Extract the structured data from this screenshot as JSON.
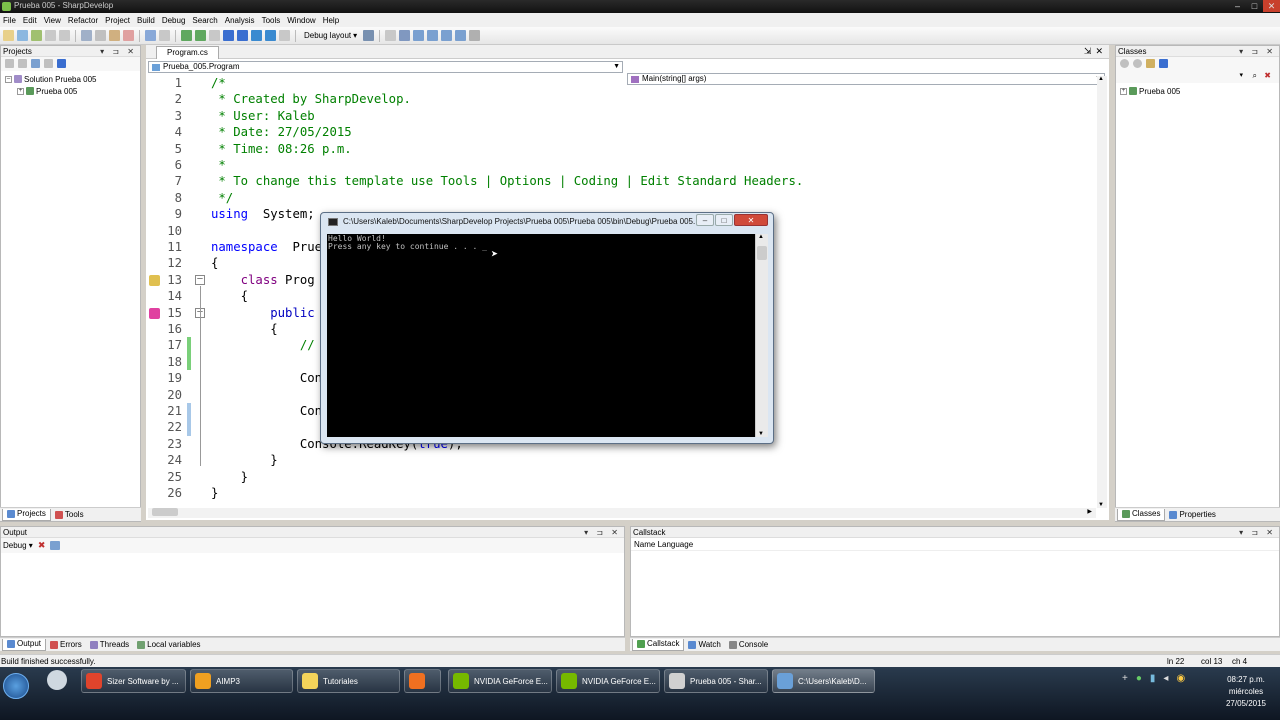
{
  "window": {
    "title": "Prueba 005 - SharpDevelop"
  },
  "menu": [
    "File",
    "Edit",
    "View",
    "Refactor",
    "Project",
    "Build",
    "Debug",
    "Search",
    "Analysis",
    "Tools",
    "Window",
    "Help"
  ],
  "toolbar": {
    "layout_label": "Debug layout"
  },
  "projects_panel": {
    "title": "Projects",
    "tree": [
      {
        "label": "Solution Prueba 005",
        "level": 0
      },
      {
        "label": "Prueba 005",
        "level": 1
      }
    ],
    "tabs": [
      "Projects",
      "Tools"
    ]
  },
  "editor": {
    "tab": "Program.cs",
    "class_combo": "Prueba_005.Program",
    "member_combo": "Main(string[] args)",
    "lines": [
      {
        "n": "1",
        "t": [
          [
            "cm",
            "/*"
          ]
        ]
      },
      {
        "n": "2",
        "t": [
          [
            "cm",
            " * Created by SharpDevelop."
          ]
        ]
      },
      {
        "n": "3",
        "t": [
          [
            "cm",
            " * User: Kaleb"
          ]
        ]
      },
      {
        "n": "4",
        "t": [
          [
            "cm",
            " * Date: 27/05/2015"
          ]
        ]
      },
      {
        "n": "5",
        "t": [
          [
            "cm",
            " * Time: 08:26 p.m."
          ]
        ]
      },
      {
        "n": "6",
        "t": [
          [
            "cm",
            " *"
          ]
        ]
      },
      {
        "n": "7",
        "t": [
          [
            "cm",
            " * To change this template use Tools | Options | Coding | Edit Standard Headers."
          ]
        ]
      },
      {
        "n": "8",
        "t": [
          [
            "cm",
            " */"
          ]
        ]
      },
      {
        "n": "9",
        "t": [
          [
            "kw",
            "using"
          ],
          [
            "",
            "  System;"
          ]
        ]
      },
      {
        "n": "10",
        "t": []
      },
      {
        "n": "11",
        "t": [
          [
            "kw",
            "namespace"
          ],
          [
            "",
            "  Prueb"
          ]
        ]
      },
      {
        "n": "12",
        "t": [
          [
            "",
            "{"
          ]
        ]
      },
      {
        "n": "13",
        "t": [
          [
            "",
            "    "
          ],
          [
            "kw2",
            "class"
          ],
          [
            "",
            " Prog"
          ]
        ]
      },
      {
        "n": "14",
        "t": [
          [
            "",
            "    {"
          ]
        ]
      },
      {
        "n": "15",
        "t": [
          [
            "",
            "        "
          ],
          [
            "kw3",
            "public"
          ]
        ]
      },
      {
        "n": "16",
        "t": [
          [
            "",
            "        {"
          ]
        ]
      },
      {
        "n": "17",
        "t": [
          [
            "",
            "            "
          ],
          [
            "cm",
            "//"
          ]
        ]
      },
      {
        "n": "18",
        "t": []
      },
      {
        "n": "19",
        "t": [
          [
            "",
            "            Con"
          ]
        ]
      },
      {
        "n": "20",
        "t": []
      },
      {
        "n": "21",
        "t": [
          [
            "",
            "            Con"
          ]
        ]
      },
      {
        "n": "22",
        "t": []
      },
      {
        "n": "23",
        "t": [
          [
            "",
            "            Console.ReadKey("
          ],
          [
            "kw",
            "true"
          ],
          [
            "",
            ");"
          ]
        ]
      },
      {
        "n": "24",
        "t": [
          [
            "",
            "        }"
          ]
        ]
      },
      {
        "n": "25",
        "t": [
          [
            "",
            "    }"
          ]
        ]
      },
      {
        "n": "26",
        "t": [
          [
            "",
            "}"
          ]
        ]
      }
    ]
  },
  "classes_panel": {
    "title": "Classes",
    "tree": [
      {
        "label": "Prueba 005"
      }
    ],
    "tabs": [
      "Classes",
      "Properties"
    ]
  },
  "console": {
    "title": "C:\\Users\\Kaleb\\Documents\\SharpDevelop Projects\\Prueba 005\\Prueba 005\\bin\\Debug\\Prueba 005...",
    "output_lines": [
      "Hello World!",
      "Press any key to continue . . . _"
    ]
  },
  "output_panel": {
    "title": "Output",
    "dropdown": "Debug",
    "tabs": [
      "Output",
      "Errors",
      "Threads",
      "Local variables"
    ]
  },
  "callstack_panel": {
    "title": "Callstack",
    "columns": "Name Language",
    "tabs": [
      "Callstack",
      "Watch",
      "Console"
    ]
  },
  "status": {
    "message": "Build finished successfully.",
    "line": "ln 22",
    "col": "col 13",
    "ch": "ch 4"
  },
  "taskbar": {
    "buttons": [
      {
        "label": "Sizer Software by ...",
        "color": "#e0442c"
      },
      {
        "label": "AIMP3",
        "color": "#f0a020"
      },
      {
        "label": "Tutoriales",
        "color": "#f3d35a"
      },
      {
        "label": "",
        "color": "#f07020"
      },
      {
        "label": "NVIDIA GeForce E...",
        "color": "#76b900"
      },
      {
        "label": "NVIDIA GeForce E...",
        "color": "#76b900"
      },
      {
        "label": "Prueba 005 - Shar...",
        "color": "#d0d0d0"
      },
      {
        "label": "C:\\Users\\Kaleb\\D...",
        "color": "#6aa0d8"
      }
    ],
    "clock_time": "08:27 p.m.",
    "clock_day": "miércoles",
    "clock_date": "27/05/2015"
  }
}
